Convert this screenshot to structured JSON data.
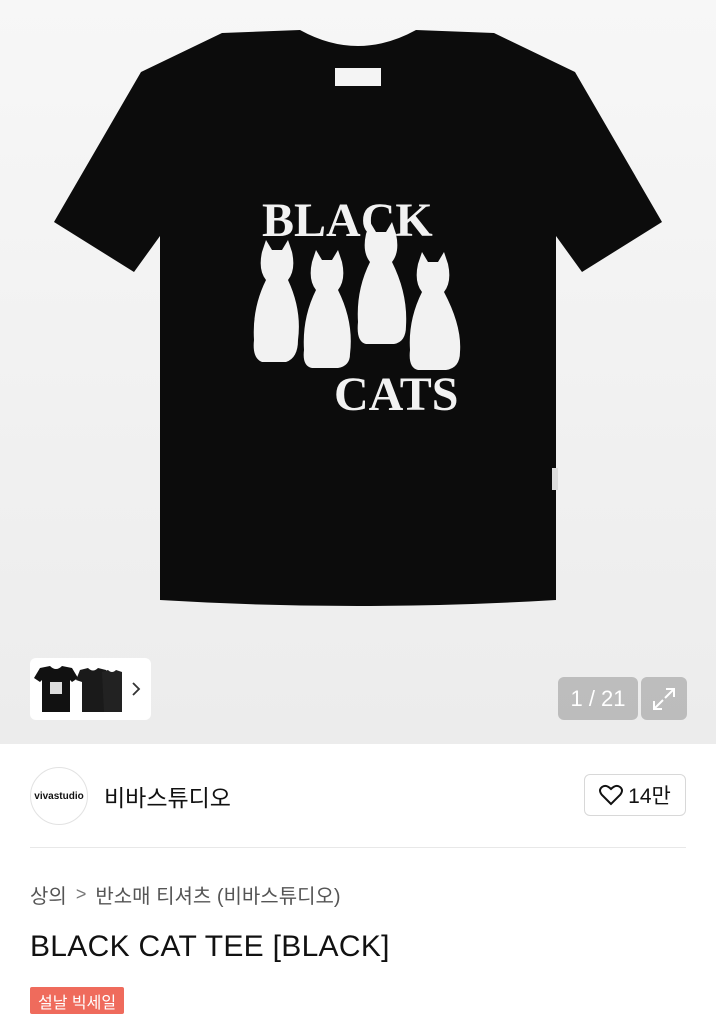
{
  "gallery": {
    "shirt_front_text_top": "BLACK",
    "shirt_front_text_bottom": "CATS",
    "counter": "1 / 21",
    "colors": {
      "shirt": "#0c0c0c",
      "print": "#f2f2f2",
      "background": "#f2f2f2"
    }
  },
  "icons": {
    "expand": "expand-icon",
    "heart": "heart-icon",
    "chevron": "chevron-right-icon"
  },
  "brand": {
    "logo_text": "vivastudio",
    "name": "비바스튜디오",
    "likes": "14만"
  },
  "breadcrumb": {
    "category": "상의",
    "separator": ">",
    "subcategory": "반소매 티셔츠 (비바스튜디오)"
  },
  "product": {
    "title": "BLACK CAT TEE [BLACK]"
  },
  "badge": {
    "label": "설날 빅세일",
    "color": "#ef6b5c"
  }
}
